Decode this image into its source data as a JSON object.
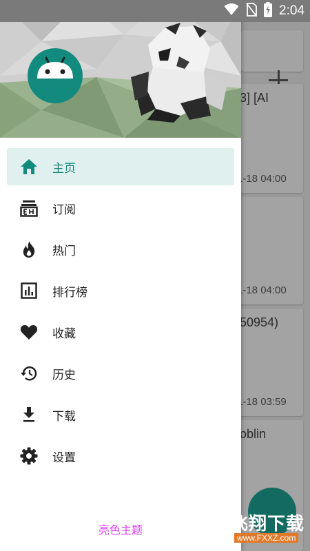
{
  "status_bar": {
    "time": "2:04",
    "icons": [
      "wifi-icon",
      "no-sim-icon",
      "battery-charging-icon"
    ]
  },
  "background": {
    "cards": [
      {
        "title": "3] [AI",
        "date": "1-18 04:00"
      },
      {
        "title": "",
        "date": "1-18 04:00"
      },
      {
        "title": "50954)",
        "date": "1-18 03:59"
      },
      {
        "title": "oblin",
        "date": ""
      }
    ]
  },
  "drawer": {
    "header": {
      "avatar_icon": "android-icon"
    },
    "menu": [
      {
        "label": "主页",
        "icon": "home-icon",
        "selected": true
      },
      {
        "label": "订阅",
        "icon": "subscription-icon",
        "selected": false
      },
      {
        "label": "热门",
        "icon": "fire-icon",
        "selected": false
      },
      {
        "label": "排行榜",
        "icon": "chart-icon",
        "selected": false
      },
      {
        "label": "收藏",
        "icon": "heart-icon",
        "selected": false
      },
      {
        "label": "历史",
        "icon": "history-icon",
        "selected": false
      },
      {
        "label": "下载",
        "icon": "download-icon",
        "selected": false
      },
      {
        "label": "设置",
        "icon": "gear-icon",
        "selected": false
      }
    ],
    "theme_toggle": "亮色主题"
  },
  "watermark": {
    "name": "飞翔下载",
    "url": "www.FXXZ.com"
  },
  "colors": {
    "accent": "#138a7e",
    "selected_bg": "#e0f0ee",
    "theme_toggle": "#e040fb"
  }
}
